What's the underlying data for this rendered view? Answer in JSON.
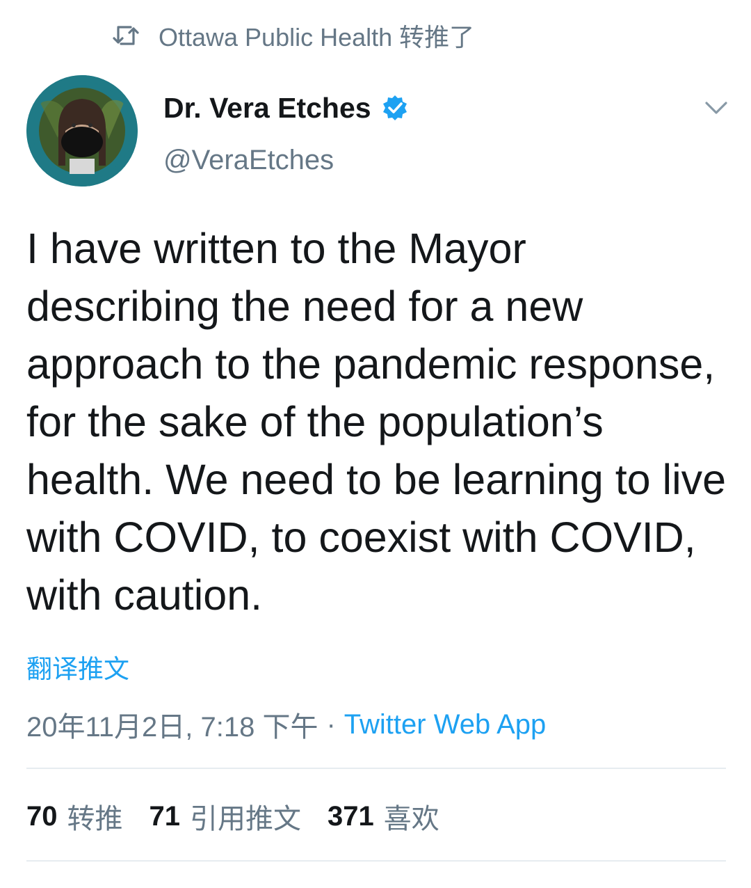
{
  "retweet_context": {
    "icon": "retweet-icon",
    "label": "Ottawa Public Health 转推了"
  },
  "author": {
    "display_name": "Dr. Vera Etches",
    "handle": "@VeraEtches",
    "verified": true
  },
  "tweet": {
    "text": "I have written to the Mayor describing the need for a new approach to the pandemic response, for the sake of the population’s health. We need to be learning to live with COVID, to coexist with COVID, with caution.",
    "translate_label": "翻译推文",
    "timestamp": "20年11月2日, 7:18 下午",
    "separator": "·",
    "source": "Twitter Web App"
  },
  "stats": {
    "retweets_count": "70",
    "retweets_label": "转推",
    "quotes_count": "71",
    "quotes_label": "引用推文",
    "likes_count": "371",
    "likes_label": "喜欢"
  },
  "colors": {
    "accent": "#1da1f2",
    "secondary_text": "#657786",
    "primary_text": "#14171a",
    "divider": "#e6ecf0"
  }
}
